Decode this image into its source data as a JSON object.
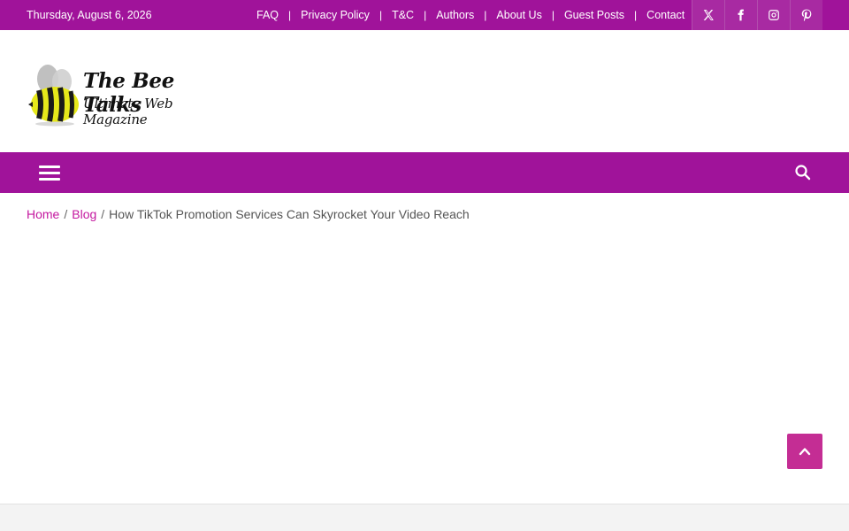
{
  "topbar": {
    "date": "Thursday, August 6, 2026",
    "links": [
      "FAQ",
      "Privacy Policy",
      "T&C",
      "Authors",
      "About Us",
      "Guest Posts",
      "Contact"
    ],
    "separator": "|",
    "social_icons": [
      "x-twitter-icon",
      "facebook-icon",
      "instagram-icon",
      "pinterest-icon"
    ]
  },
  "header": {
    "logo_title": "The Bee Talks",
    "logo_tagline": "Ultimate Web Magazine"
  },
  "breadcrumb": {
    "home": "Home",
    "blog": "Blog",
    "separator": "/",
    "current": "How TikTok Promotion Services Can Skyrocket Your Video Reach"
  },
  "colors": {
    "brand": "#a0139a",
    "link": "#c4179f",
    "to_top": "#c42d94"
  }
}
